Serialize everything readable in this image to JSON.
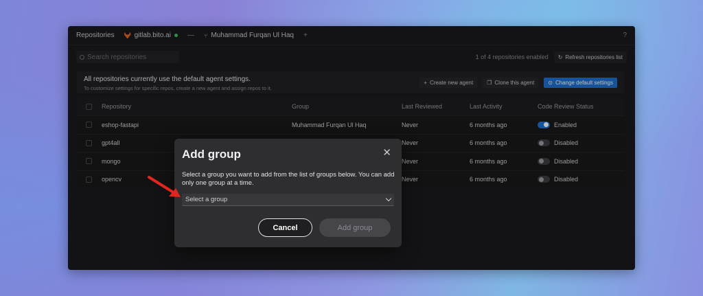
{
  "colors": {
    "accent": "#1e6fcf",
    "danger_arrow": "#e0261e",
    "gitlab": "#e2622a",
    "status_green": "#3fbf5f"
  },
  "topbar": {
    "section": "Repositories",
    "host": "gitlab.bito.ai",
    "ellipsis": "—",
    "user": "Muhammad Furqan Ul Haq",
    "add": "+",
    "help": "?"
  },
  "search": {
    "placeholder": "Search repositories"
  },
  "summary": {
    "enabled_count": "1 of 4 repositories enabled",
    "refresh_label": "Refresh repositories list"
  },
  "info": {
    "title": "All repositories currently use the default agent settings.",
    "subtitle": "To customize settings for specific repos, create a new agent and assign repos to it.",
    "create_agent": "Create new agent",
    "clone_agent": "Clone this agent",
    "change_default": "Change default settings"
  },
  "table": {
    "headers": [
      "Repository",
      "Group",
      "Last Reviewed",
      "Last Activity",
      "Code Review Status"
    ],
    "rows": [
      {
        "repo": "eshop-fastapi",
        "group": "Muhammad Furqan Ul Haq",
        "reviewed": "Never",
        "activity": "6 months ago",
        "status": "Enabled",
        "on": true
      },
      {
        "repo": "gpt4all",
        "group": "",
        "reviewed": "Never",
        "activity": "6 months ago",
        "status": "Disabled",
        "on": false
      },
      {
        "repo": "mongo",
        "group": "",
        "reviewed": "Never",
        "activity": "6 months ago",
        "status": "Disabled",
        "on": false
      },
      {
        "repo": "opencv",
        "group": "",
        "reviewed": "Never",
        "activity": "6 months ago",
        "status": "Disabled",
        "on": false
      }
    ]
  },
  "modal": {
    "title": "Add group",
    "close": "✕",
    "description": "Select a group you want to add from the list of groups below. You can add only one group at a time.",
    "select_placeholder": "Select a group",
    "cancel": "Cancel",
    "add": "Add group"
  }
}
